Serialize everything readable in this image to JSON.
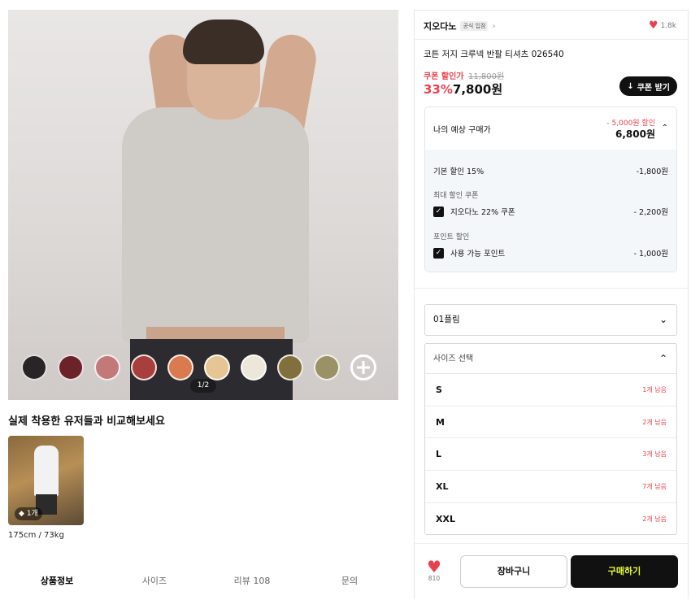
{
  "gallery": {
    "pager": "1/2",
    "swatches": [
      "#2a2427",
      "#6b2228",
      "#c27a78",
      "#a83f3c",
      "#d97b4e",
      "#e5c593",
      "#ece7d9",
      "#7f703d",
      "#9a9166"
    ]
  },
  "ugc": {
    "title": "실제 착용한 유저들과 비교해보세요",
    "badge": "1개",
    "caption": "175cm / 73kg"
  },
  "tabs": [
    {
      "label": "상품정보",
      "active": true
    },
    {
      "label": "사이즈",
      "active": false
    },
    {
      "label": "리뷰 108",
      "active": false
    },
    {
      "label": "문의",
      "active": false
    }
  ],
  "product": {
    "brand": "지오다노",
    "brand_badge": "공식 입점",
    "likes": "1.8k",
    "name": "코튼 저지 크루넥 반팔 티셔츠 026540",
    "coupon_price_label": "쿠폰 할인가",
    "original_price": "11,800원",
    "discount_percent": "33%",
    "price": "7,800원",
    "coupon_button": "쿠폰 받기"
  },
  "estimate": {
    "title": "나의 예상 구매가",
    "discount": "- 5,000원 할인",
    "price": "6,800원",
    "base_label": "기본 할인 15%",
    "base_value": "-1,800원",
    "coupon_section": "최대 할인 쿠폰",
    "coupon_label": "지오다노 22% 쿠폰",
    "coupon_value": "- 2,200원",
    "point_section": "포인트 할인",
    "point_label": "사용 가능 포인트",
    "point_value": "- 1,000원"
  },
  "options": {
    "color_selected": "01플림",
    "size_placeholder": "사이즈 선택",
    "sizes": [
      {
        "label": "S",
        "stock": "1개 남음"
      },
      {
        "label": "M",
        "stock": "2개 남음"
      },
      {
        "label": "L",
        "stock": "3개 남음"
      },
      {
        "label": "XL",
        "stock": "7개 남음"
      },
      {
        "label": "XXL",
        "stock": "2개 남음"
      }
    ]
  },
  "bottom": {
    "like_count": "810",
    "cart": "장바구니",
    "buy": "구매하기"
  }
}
